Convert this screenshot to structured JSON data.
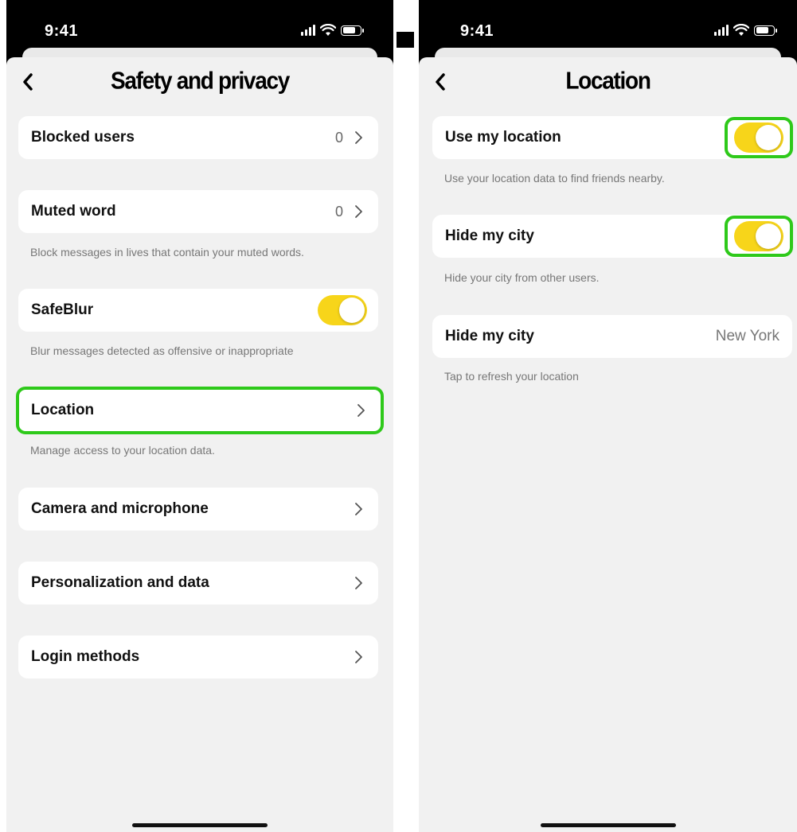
{
  "status_bar": {
    "time": "9:41"
  },
  "left_screen": {
    "title": "Safety and privacy",
    "rows": [
      {
        "label": "Blocked users",
        "count": "0",
        "hint": ""
      },
      {
        "label": "Muted word",
        "count": "0",
        "hint": "Block messages in lives that contain your muted words."
      },
      {
        "label": "SafeBlur",
        "toggle_on": true,
        "hint": "Blur messages detected as offensive or inappropriate"
      },
      {
        "label": "Location",
        "hint": "Manage access to your location data."
      },
      {
        "label": "Camera and microphone",
        "hint": ""
      },
      {
        "label": "Personalization and data",
        "hint": ""
      },
      {
        "label": "Login methods",
        "hint": ""
      }
    ]
  },
  "right_screen": {
    "title": "Location",
    "rows": [
      {
        "label": "Use my location",
        "toggle_on": true,
        "hint": "Use your location data to find friends nearby."
      },
      {
        "label": "Hide my city",
        "toggle_on": true,
        "hint": "Hide your city from other users."
      },
      {
        "label": "Hide my city",
        "value": "New York",
        "hint": "Tap to refresh your location"
      }
    ]
  },
  "colors": {
    "toggle_on": "#f7d51a",
    "highlight": "#2ec91a",
    "sheet_bg": "#f1f1f1"
  }
}
